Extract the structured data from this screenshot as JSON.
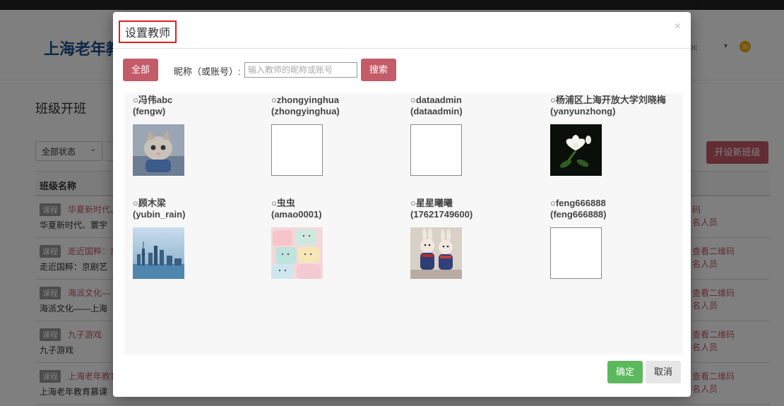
{
  "header": {
    "site_title": "上海老年教",
    "user_fragment": "oc",
    "caret": "▾",
    "badge_count": "30"
  },
  "page": {
    "title": "班级开班",
    "status_filter": "全部状态",
    "new_class_button": "开设新班级",
    "table_header": "班级名称",
    "rows": [
      {
        "tag": "课程",
        "subtitle": "华夏新时代、",
        "name": "华夏新时代、寰宇",
        "action1": "码",
        "action2": "名人员"
      },
      {
        "tag": "课程",
        "subtitle": "走近国粹：京",
        "name": "走近国粹：京剧艺",
        "action1": "查看二维码",
        "action2": "名人员"
      },
      {
        "tag": "课程",
        "subtitle": "海派文化—",
        "name": "海派文化——上海",
        "action1": "查看二维码",
        "action2": "名人员"
      },
      {
        "tag": "课程",
        "subtitle": "九子游戏",
        "name": "九子游戏",
        "action1": "查看二维码",
        "action2": "名人员"
      },
      {
        "tag": "课程",
        "subtitle": "上海老年教育",
        "name": "上海老年教育慕课",
        "action1": "查看二维码",
        "action2": "名人员"
      }
    ]
  },
  "modal": {
    "title": "设置教师",
    "close": "×",
    "all_button": "全部",
    "filter_label": "昵称（或账号）:",
    "search_placeholder": "输入教师的昵称或账号",
    "search_button": "搜索",
    "confirm_button": "确定",
    "cancel_button": "取消",
    "teachers": [
      {
        "name": "○冯伟abc",
        "account": "(fengw)",
        "avatar": "cat-photo"
      },
      {
        "name": "○zhongyinghua",
        "account": "(zhongyinghua)",
        "avatar": "empty"
      },
      {
        "name": "○dataadmin",
        "account": "(dataadmin)",
        "avatar": "empty"
      },
      {
        "name": "○杨浦区上海开放大学刘晓梅",
        "account": "(yanyunzhong)",
        "avatar": "flower-photo"
      },
      {
        "name": "○顾木梁",
        "account": "(yubin_rain)",
        "avatar": "city-skyline-photo"
      },
      {
        "name": "○虫虫",
        "account": "(amao0001)",
        "avatar": "marshmallow-photo"
      },
      {
        "name": "○星星曦曦",
        "account": "(17621749600)",
        "avatar": "toy-rabbits-photo"
      },
      {
        "name": "○feng666888",
        "account": "(feng666888)",
        "avatar": "empty"
      }
    ]
  },
  "colors": {
    "brand_red": "#c45b68",
    "confirm_green": "#5cb85c",
    "title_blue": "#1c4e8e",
    "highlight_border": "#e02020"
  }
}
